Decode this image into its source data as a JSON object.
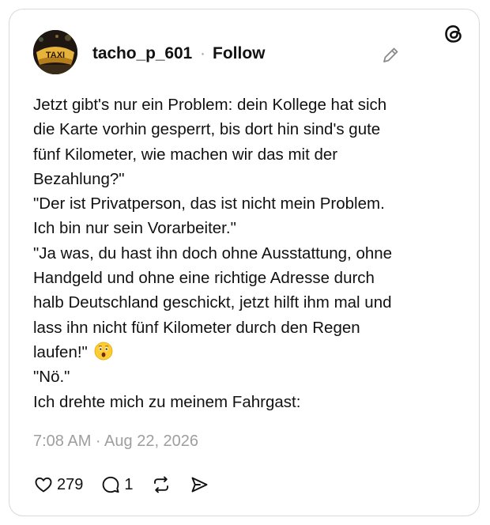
{
  "post": {
    "author": {
      "username": "tacho_p_601",
      "avatar_sign_text": "TAXI"
    },
    "separator": "·",
    "follow_label": "Follow",
    "body_lines": [
      "Jetzt gibt's nur ein Problem: dein Kollege hat sich",
      "die Karte vorhin gesperrt, bis dort hin sind's gute",
      "fünf Kilometer, wie machen wir das mit der",
      "Bezahlung?\"",
      "\"Der ist Privatperson, das ist nicht mein Problem.",
      "Ich bin nur sein Vorarbeiter.\"",
      "\"Ja was, du hast ihn doch ohne Ausstattung, ohne",
      "Handgeld und ohne eine richtige Adresse durch",
      "halb Deutschland geschickt, jetzt hilft ihm mal und",
      "lass ihn nicht fünf Kilometer durch den Regen",
      "laufen!\" ",
      "\"Nö.\"",
      "Ich drehte mich zu meinem Fahrgast:"
    ],
    "emoji": "astonished-face",
    "timestamp": "7:08 AM · Aug 22, 2026",
    "stats": {
      "likes": "279",
      "replies": "1"
    }
  },
  "icons": {
    "brand": "threads-logo-icon",
    "edit": "pencil-icon",
    "like": "heart-icon",
    "reply": "comment-icon",
    "repost": "repost-icon",
    "share": "send-icon"
  },
  "colors": {
    "text": "#111111",
    "muted": "#9e9e9e",
    "border": "#d9d9d9"
  }
}
